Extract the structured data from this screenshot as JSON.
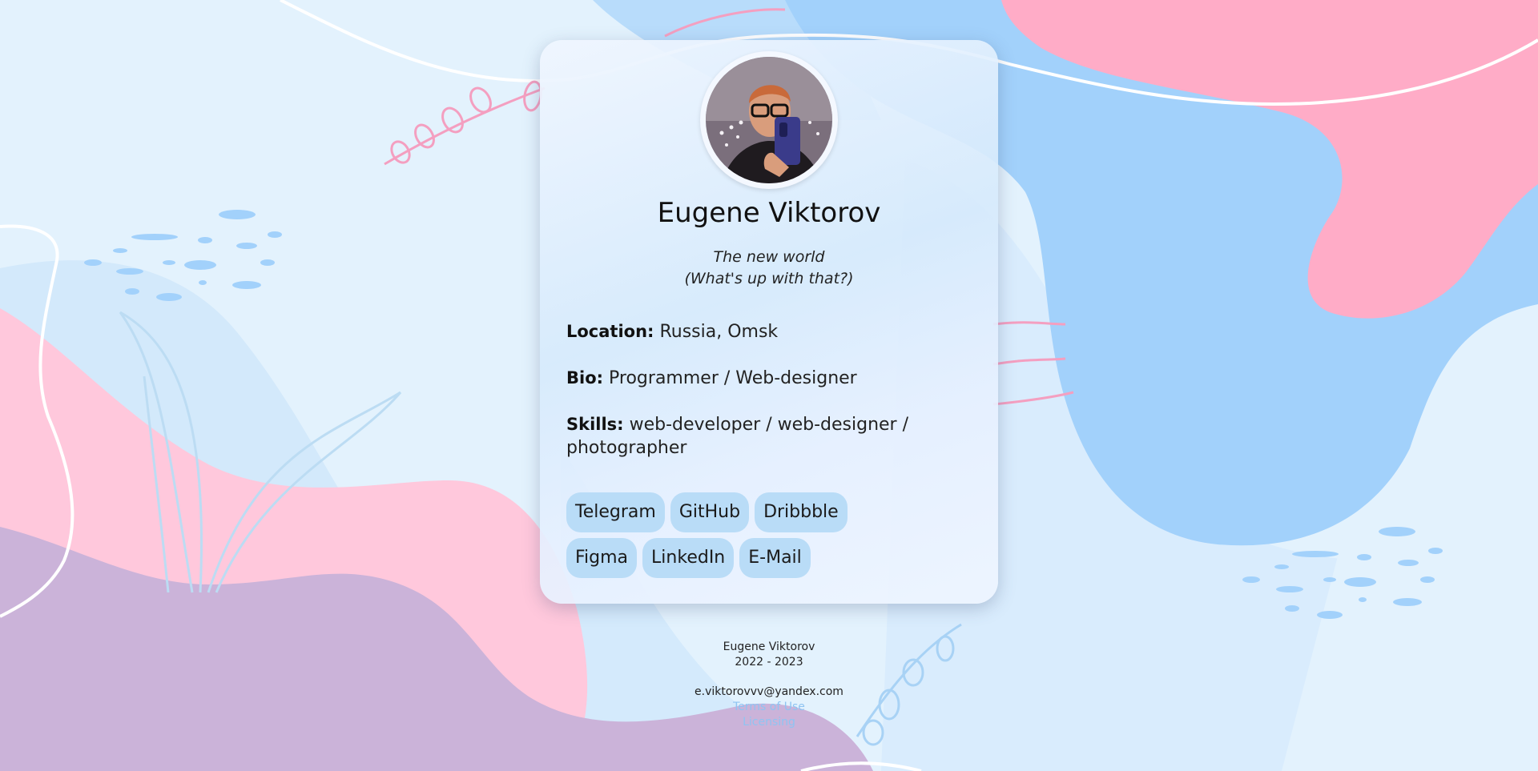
{
  "profile": {
    "name": "Eugene Viktorov",
    "motto_line1": "The new world",
    "motto_line2": "(What's up with that?)",
    "location_label": "Location:",
    "location_value": "Russia, Omsk",
    "bio_label": "Bio:",
    "bio_value": "Programmer / Web-designer",
    "skills_label": "Skills:",
    "skills_value": "web-developer / web-designer / photographer"
  },
  "links": [
    {
      "label": "Telegram"
    },
    {
      "label": "GitHub"
    },
    {
      "label": "Dribbble"
    },
    {
      "label": "Figma"
    },
    {
      "label": "LinkedIn"
    },
    {
      "label": "E-Mail"
    }
  ],
  "footer": {
    "author": "Eugene Viktorov",
    "years": "2022 - 2023",
    "email": "e.viktorovvv@yandex.com",
    "terms": "Terms of Use",
    "licensing": "Licensing"
  },
  "colors": {
    "background": "#e3f2fd",
    "pink": "#ffc8dc",
    "blue": "#a2d1fb",
    "purple": "#cbb3d9",
    "link_chip": "#b9dcf7",
    "footer_link": "#8fc4f2"
  },
  "icons": {
    "avatar": "profile-photo"
  }
}
